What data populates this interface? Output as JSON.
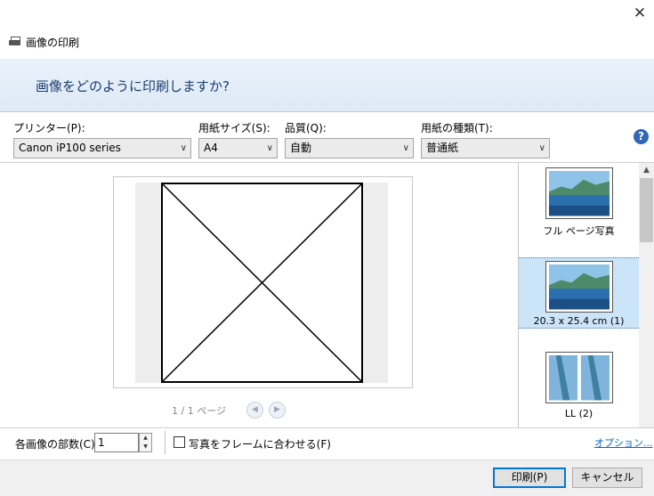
{
  "window": {
    "title": "画像の印刷",
    "close_symbol": "✕",
    "heading": "画像をどのように印刷しますか?"
  },
  "settings": {
    "printer_label": "プリンター(P):",
    "printer_value": "Canon iP100 series",
    "paper_size_label": "用紙サイズ(S):",
    "paper_size_value": "A4",
    "quality_label": "品質(Q):",
    "quality_value": "自動",
    "paper_type_label": "用紙の種類(T):",
    "paper_type_value": "普通紙",
    "help_symbol": "?"
  },
  "preview": {
    "page_indicator": "1 / 1 ページ",
    "prev_symbol": "◀",
    "next_symbol": "▶"
  },
  "layouts": [
    {
      "label": "フル ページ写真",
      "selected": false
    },
    {
      "label": "20.3 x 25.4 cm (1)",
      "selected": true
    },
    {
      "label": "LL (2)",
      "selected": false
    }
  ],
  "bottom": {
    "copies_label": "各画像の部数(C):",
    "copies_value": "1",
    "fit_label": "写真をフレームに合わせる(F)",
    "fit_checked": false,
    "options_link": "オプション..."
  },
  "buttons": {
    "print": "印刷(P)",
    "cancel": "キャンセル"
  },
  "colors": {
    "banner_text": "#1a3e6e",
    "selection": "#cce4f7",
    "link": "#0066cc",
    "primary_border": "#0078d7"
  }
}
